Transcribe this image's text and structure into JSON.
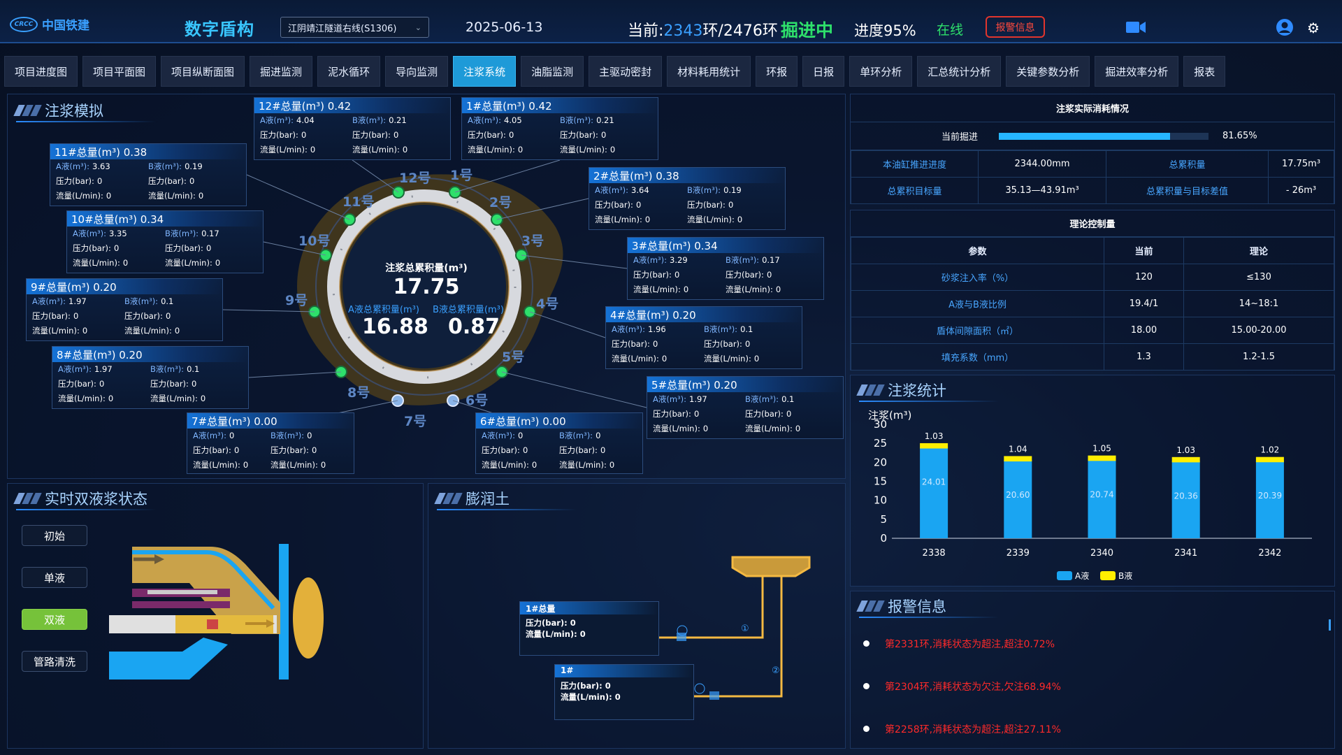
{
  "header": {
    "logo_text": "中国铁建",
    "logo_mark": "CRCC",
    "app_title": "数字盾构",
    "tunnel_select": "江阴靖江隧道右线(S1306)",
    "date": "2025-06-13",
    "ring_prefix": "当前:",
    "ring_current": "2343",
    "ring_total": "环/2476环",
    "status": "掘进中",
    "progress": "进度95%",
    "online": "在线",
    "alarm_button": "报警信息"
  },
  "nav": {
    "tabs": [
      "项目进度图",
      "项目平面图",
      "项目纵断面图",
      "掘进监测",
      "泥水循环",
      "导向监测",
      "注浆系统",
      "油脂监测",
      "主驱动密封",
      "材料耗用统计",
      "环报",
      "日报",
      "单环分析",
      "汇总统计分析",
      "关键参数分析",
      "掘进效率分析",
      "报表"
    ],
    "active": "注浆系统"
  },
  "grout_sim": {
    "title": "注浆模拟",
    "center_label": "注浆总累积量(m³)",
    "center_total": "17.75",
    "a_label": "A液总累积量(m³)",
    "a_total": "16.88",
    "b_label": "B液总累积量(m³)",
    "b_total": "0.87",
    "ports": [
      "1号",
      "2号",
      "3号",
      "4号",
      "5号",
      "6号",
      "7号",
      "8号",
      "9号",
      "10号",
      "11号",
      "12号"
    ],
    "labels": {
      "a": "A液(m³):",
      "b": "B液(m³):",
      "pa": "压力(bar):",
      "pb": "压力(bar):",
      "fa": "流量(L/min):",
      "fb": "流量(L/min):"
    },
    "boxes": [
      {
        "title": "12#总量(m³) 0.42",
        "a": "4.04",
        "b": "0.21",
        "pa": "0",
        "pb": "0",
        "fa": "0",
        "fb": "0"
      },
      {
        "title": "1#总量(m³) 0.42",
        "a": "4.05",
        "b": "0.21",
        "pa": "0",
        "pb": "0",
        "fa": "0",
        "fb": "0"
      },
      {
        "title": "11#总量(m³) 0.38",
        "a": "3.63",
        "b": "0.19",
        "pa": "0",
        "pb": "0",
        "fa": "0",
        "fb": "0"
      },
      {
        "title": "2#总量(m³) 0.38",
        "a": "3.64",
        "b": "0.19",
        "pa": "0",
        "pb": "0",
        "fa": "0",
        "fb": "0"
      },
      {
        "title": "10#总量(m³) 0.34",
        "a": "3.35",
        "b": "0.17",
        "pa": "0",
        "pb": "0",
        "fa": "0",
        "fb": "0"
      },
      {
        "title": "3#总量(m³) 0.34",
        "a": "3.29",
        "b": "0.17",
        "pa": "0",
        "pb": "0",
        "fa": "0",
        "fb": "0"
      },
      {
        "title": "9#总量(m³) 0.20",
        "a": "1.97",
        "b": "0.1",
        "pa": "0",
        "pb": "0",
        "fa": "0",
        "fb": "0"
      },
      {
        "title": "4#总量(m³) 0.20",
        "a": "1.96",
        "b": "0.1",
        "pa": "0",
        "pb": "0",
        "fa": "0",
        "fb": "0"
      },
      {
        "title": "8#总量(m³) 0.20",
        "a": "1.97",
        "b": "0.1",
        "pa": "0",
        "pb": "0",
        "fa": "0",
        "fb": "0"
      },
      {
        "title": "5#总量(m³) 0.20",
        "a": "1.97",
        "b": "0.1",
        "pa": "0",
        "pb": "0",
        "fa": "0",
        "fb": "0"
      },
      {
        "title": "7#总量(m³) 0.00",
        "a": "0",
        "b": "0",
        "pa": "0",
        "pb": "0",
        "fa": "0",
        "fb": "0"
      },
      {
        "title": "6#总量(m³) 0.00",
        "a": "0",
        "b": "0",
        "pa": "0",
        "pb": "0",
        "fa": "0",
        "fb": "0"
      }
    ]
  },
  "consumption": {
    "title": "注浆实际消耗情况",
    "current_label": "当前掘进",
    "current_pct": "81.65%",
    "current_fraction": 0.8165,
    "rows": [
      {
        "l1": "本油缸推进进度",
        "v1": "2344.00mm",
        "l2": "总累积量",
        "v2": "17.75m³"
      },
      {
        "l1": "总累积目标量",
        "v1": "35.13—43.91m³",
        "l2": "总累积量与目标差值",
        "v2": "- 26m³"
      }
    ]
  },
  "theory": {
    "title": "理论控制量",
    "headers": [
      "参数",
      "当前",
      "理论"
    ],
    "rows": [
      [
        "砂浆注入率（%）",
        "120",
        "≤130"
      ],
      [
        "A液与B液比例",
        "19.4/1",
        "14~18:1"
      ],
      [
        "盾体间隙面积（㎡）",
        "18.00",
        "15.00-20.00"
      ],
      [
        "填充系数（mm）",
        "1.3",
        "1.2-1.5"
      ]
    ]
  },
  "grout_stats": {
    "title": "注浆统计"
  },
  "chart_data": {
    "type": "bar",
    "ylabel": "注浆(m³)",
    "ylim": [
      0,
      30
    ],
    "yticks": [
      0,
      5,
      10,
      15,
      20,
      25,
      30
    ],
    "categories": [
      "2338",
      "2339",
      "2340",
      "2341",
      "2342"
    ],
    "series": [
      {
        "name": "A液",
        "color": "#1aa5f2",
        "values": [
          24.01,
          20.6,
          20.74,
          20.36,
          20.39
        ]
      },
      {
        "name": "B液",
        "color": "#ffee00",
        "values": [
          1.03,
          1.04,
          1.05,
          1.03,
          1.02
        ]
      }
    ],
    "stacked": true,
    "legend": "bottom-center"
  },
  "dual_liquid": {
    "title": "实时双液浆状态",
    "buttons": [
      "初始",
      "单液",
      "双液",
      "管路清洗"
    ],
    "active": "双液"
  },
  "bentonite": {
    "title": "膨润土",
    "box1": {
      "title": "1#总量",
      "p_label": "压力(bar):",
      "p": "0",
      "f_label": "流量(L/min):",
      "f": "0"
    },
    "box2": {
      "title": "1#",
      "p_label": "压力(bar):",
      "p": "0",
      "f_label": "流量(L/min):",
      "f": "0"
    },
    "marker1": "①",
    "marker2": "②"
  },
  "alarms": {
    "title": "报警信息",
    "items": [
      "第2331环,消耗状态为超注,超注0.72%",
      "第2304环,消耗状态为欠注,欠注68.94%",
      "第2258环,消耗状态为超注,超注27.11%"
    ]
  },
  "icons": {
    "camera": "camera-icon",
    "user": "user-icon",
    "settings": "gear-icon"
  }
}
